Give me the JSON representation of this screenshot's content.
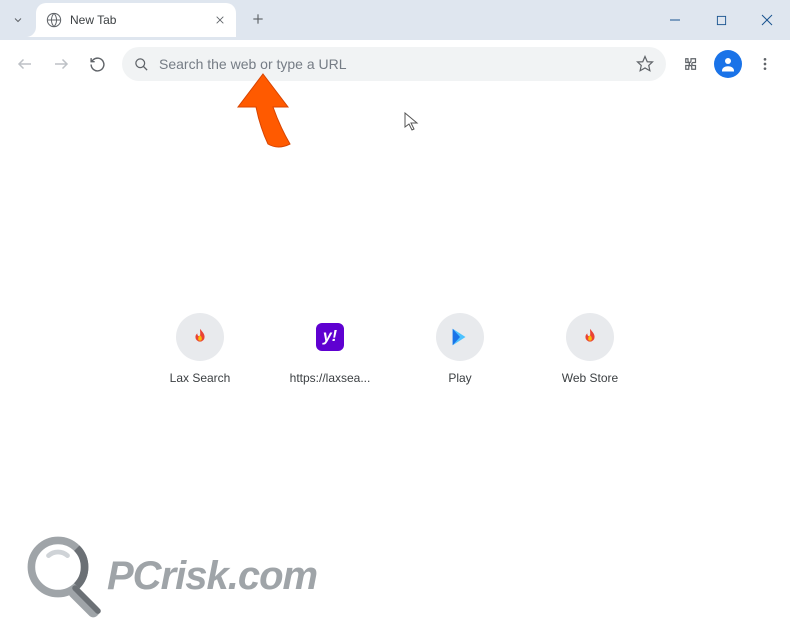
{
  "tab": {
    "title": "New Tab"
  },
  "omnibox": {
    "placeholder": "Search the web or type a URL"
  },
  "shortcuts": [
    {
      "label": "Lax Search",
      "icon": "flame"
    },
    {
      "label": "https://laxsea...",
      "icon": "yahoo"
    },
    {
      "label": "Play",
      "icon": "play"
    },
    {
      "label": "Web Store",
      "icon": "flame"
    }
  ],
  "watermark": {
    "text": "PCrisk.com"
  }
}
